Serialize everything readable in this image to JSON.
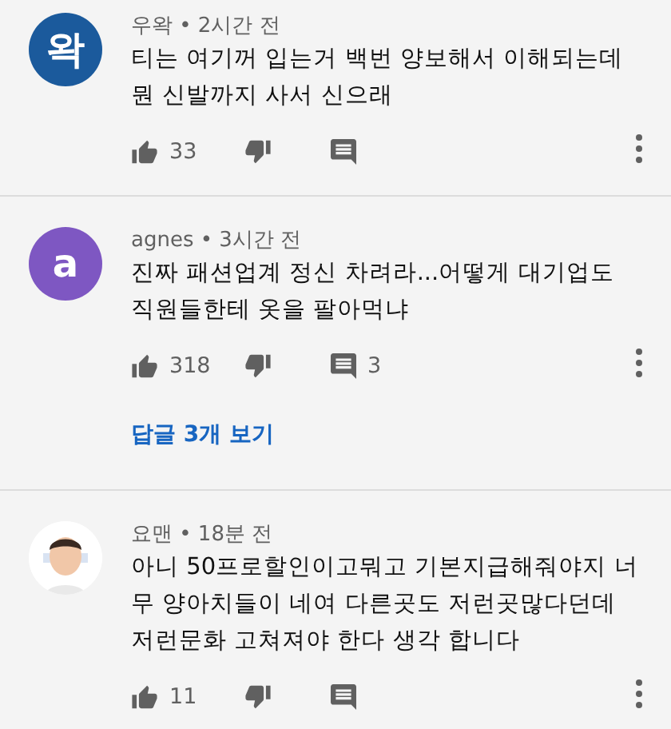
{
  "comments": [
    {
      "avatar": {
        "kind": "letter",
        "letter": "왁",
        "color": "#1b5a9c"
      },
      "meta": "우왁 • 2시간 전",
      "text": "티는 여기꺼 입는거 백번 양보해서 이해되는데 뭔 신발까지 사서 신으래",
      "likes": "33"
    },
    {
      "avatar": {
        "kind": "letter",
        "letter": "a",
        "color": "#7e57c2"
      },
      "meta": "agnes • 3시간 전",
      "text": "진짜 패션업계 정신 차려라...어떻게 대기업도 직원들한테 옷을 팔아먹냐",
      "likes": "318",
      "reply_count": "3",
      "view_replies": "답글 3개 보기"
    },
    {
      "meta": "요맨 • 18분 전",
      "text": "아니 50프로할인이고뭐고 기본지급해줘야지 너무 양아치들이 네여 다른곳도 저런곳많다던데 저런문화 고쳐져야 한다 생각 합니다",
      "likes": "11"
    }
  ]
}
